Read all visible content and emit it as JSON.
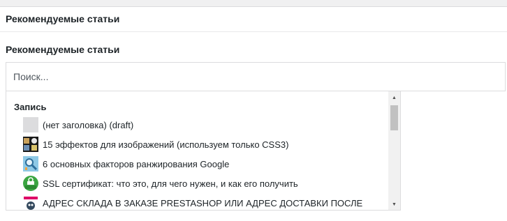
{
  "panel": {
    "title": "Рекомендуемые статьи"
  },
  "field": {
    "label": "Рекомендуемые статьи"
  },
  "search": {
    "placeholder": "Поиск..."
  },
  "results": {
    "group_label": "Запись",
    "items": [
      {
        "label": "(нет заголовка) (draft)",
        "thumb": "blank-thumbnail"
      },
      {
        "label": "15 эффектов для изображений (используем только CSS3)",
        "thumb": "image-effects-thumbnail"
      },
      {
        "label": "6 основных факторов ранжирования Google",
        "thumb": "seo-magnifier-thumbnail"
      },
      {
        "label": "SSL сертификат: что это, для чего нужен, и как его получить",
        "thumb": "ssl-badge-thumbnail"
      },
      {
        "label": "АДРЕС СКЛАДА В ЗАКАЗЕ  PRESTASHOP ИЛИ АДРЕС ДОСТАВКИ ПОСЛЕ",
        "thumb": "prestashop-logo-thumbnail"
      }
    ]
  },
  "scrollbar": {
    "up_glyph": "▲",
    "down_glyph": "▼"
  },
  "colors": {
    "text": "#1d2327",
    "border": "#dcdcde",
    "ssl_green": "#3ba642",
    "scroll_thumb": "#c1c1c1"
  }
}
